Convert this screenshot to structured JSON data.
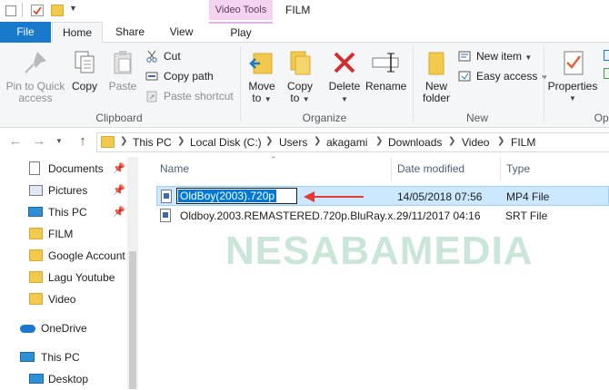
{
  "window": {
    "title": "FILM",
    "context_tab_group": "Video Tools"
  },
  "ribbon_tabs": [
    "File",
    "Home",
    "Share",
    "View",
    "Play"
  ],
  "ribbon": {
    "clipboard": {
      "pin_to_quick_access": "Pin to Quick access",
      "copy": "Copy",
      "paste": "Paste",
      "cut": "Cut",
      "copy_path": "Copy path",
      "paste_shortcut": "Paste shortcut",
      "label": "Clipboard"
    },
    "organize": {
      "move_to": "Move to",
      "copy_to": "Copy to",
      "delete": "Delete",
      "rename": "Rename",
      "label": "Organize"
    },
    "new": {
      "new_folder": "New folder",
      "new_item": "New item",
      "easy_access": "Easy access",
      "label": "New"
    },
    "open": {
      "properties": "Properties",
      "label": "Ope"
    }
  },
  "address": {
    "crumbs": [
      "This PC",
      "Local Disk (C:)",
      "Users",
      "akagami",
      "Downloads",
      "Video",
      "FILM"
    ]
  },
  "nav_pane": {
    "items": [
      {
        "label": "Documents",
        "icon": "documents-icon",
        "pinned": true
      },
      {
        "label": "Pictures",
        "icon": "pictures-icon",
        "pinned": true
      },
      {
        "label": "This PC",
        "icon": "computer-icon",
        "pinned": true
      },
      {
        "label": "FILM",
        "icon": "folder-icon",
        "pinned": false
      },
      {
        "label": "Google Account",
        "icon": "folder-icon",
        "pinned": false
      },
      {
        "label": "Lagu Youtube",
        "icon": "folder-icon",
        "pinned": false
      },
      {
        "label": "Video",
        "icon": "folder-icon",
        "pinned": false
      },
      {
        "label": "OneDrive",
        "icon": "onedrive-icon",
        "pinned": false
      },
      {
        "label": "This PC",
        "icon": "computer-icon",
        "pinned": false
      },
      {
        "label": "Desktop",
        "icon": "desktop-icon",
        "pinned": false
      }
    ]
  },
  "file_list": {
    "columns": [
      "Name",
      "Date modified",
      "Type"
    ],
    "rows": [
      {
        "name": "OldBoy(2003).720p",
        "date": "14/05/2018 07:56",
        "type": "MP4 File",
        "renaming": true
      },
      {
        "name": "Oldboy.2003.REMASTERED.720p.BluRay.x...",
        "date": "29/11/2017 04:16",
        "type": "SRT File",
        "renaming": false
      }
    ]
  },
  "watermark": "NESABAMEDIA",
  "colors": {
    "accent": "#1979ca",
    "selection": "#cce8ff",
    "annotation_arrow": "#e53935",
    "video_tools": "#f3d3f0"
  }
}
